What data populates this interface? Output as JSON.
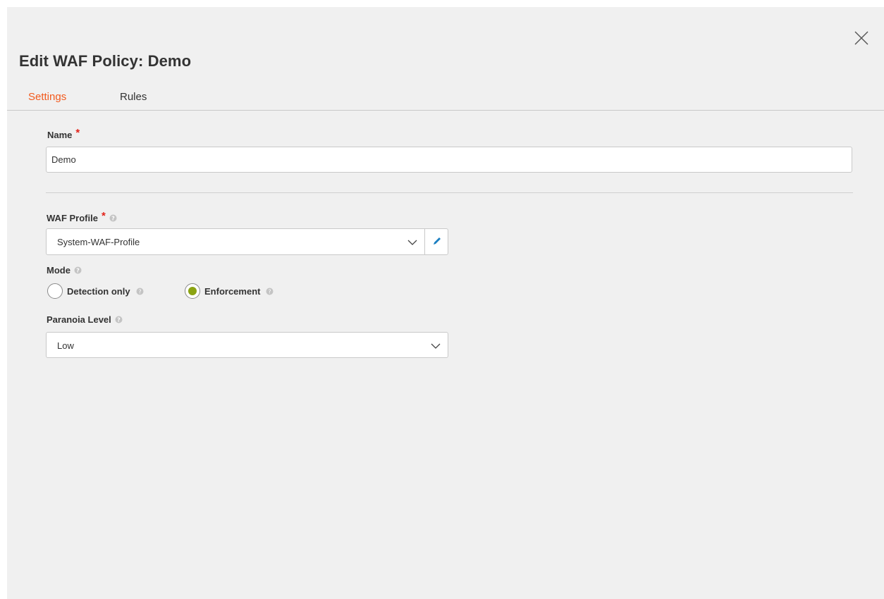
{
  "dialog": {
    "title": "Edit WAF Policy: Demo"
  },
  "tabs": [
    {
      "label": "Settings",
      "active": true
    },
    {
      "label": "Rules",
      "active": false
    }
  ],
  "form": {
    "name": {
      "label": "Name",
      "required_mark": "*",
      "value": "Demo"
    },
    "waf_profile": {
      "label": "WAF Profile",
      "required_mark": "*",
      "selected": "System-WAF-Profile",
      "help_icon": "question-circle-icon",
      "edit_icon": "pencil-icon"
    },
    "mode": {
      "label": "Mode",
      "options": [
        {
          "label": "Detection only",
          "checked": false
        },
        {
          "label": "Enforcement",
          "checked": true
        }
      ]
    },
    "paranoia_level": {
      "label": "Paranoia Level",
      "selected": "Low"
    }
  },
  "colors": {
    "accent_tab": "#f25a1d",
    "required": "#e2231a",
    "radio_checked": "#8ba312",
    "edit_icon": "#1a7fc1",
    "background": "#f0f0f0"
  }
}
